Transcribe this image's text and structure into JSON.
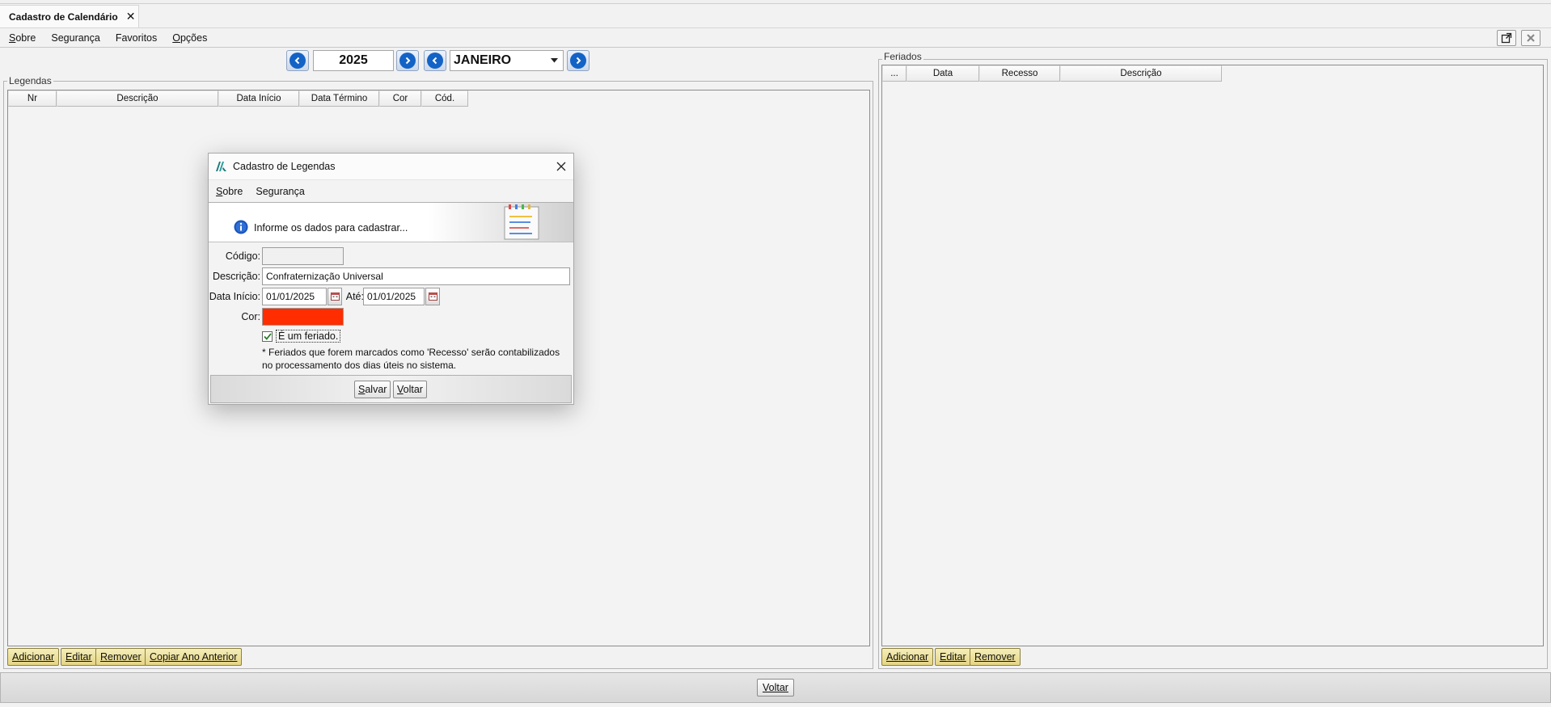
{
  "tab": {
    "title": "Cadastro de Calendário",
    "close": "✕"
  },
  "menu": [
    {
      "label": "Sobre",
      "u": "S",
      "rest": "obre"
    },
    {
      "label": "Segurança"
    },
    {
      "label": "Favoritos"
    },
    {
      "label": "Opções",
      "u": "O",
      "rest": "pções"
    }
  ],
  "nav": {
    "year": "2025",
    "month": "JANEIRO"
  },
  "legendas": {
    "title": "Legendas",
    "columns": [
      "Nr",
      "Descrição",
      "Data Início",
      "Data Término",
      "Cor",
      "Cód."
    ],
    "buttons": [
      "Adicionar",
      "Editar",
      "Remover",
      "Copiar Ano Anterior"
    ]
  },
  "feriados": {
    "title": "Feriados",
    "columns": [
      "...",
      "Data",
      "Recesso",
      "Descrição"
    ],
    "buttons": [
      "Adicionar",
      "Editar",
      "Remover"
    ]
  },
  "footer": {
    "voltar": "Voltar"
  },
  "dialog": {
    "title": "Cadastro de Legendas",
    "menu": [
      "Sobre",
      "Segurança"
    ],
    "info": "Informe os dados para cadastrar...",
    "labels": {
      "codigo": "Código:",
      "descricao": "Descrição:",
      "data_inicio": "Data Início:",
      "ate": "Até:",
      "cor": "Cor:"
    },
    "values": {
      "codigo": "",
      "descricao": "Confraternização Universal",
      "data_inicio": "01/01/2025",
      "ate": "01/01/2025",
      "cor_hex": "#ff2d00"
    },
    "checkbox": {
      "label": "É um feriado.",
      "checked": true
    },
    "note_line1": "* Feriados que forem marcados como 'Recesso' serão contabilizados",
    "note_line2": "no processamento dos dias úteis no sistema.",
    "buttons": {
      "salvar": "Salvar",
      "voltar": "Voltar"
    }
  },
  "colors": {
    "accent_blue": "#1363c6",
    "yellow_button": "#e9dc95"
  }
}
